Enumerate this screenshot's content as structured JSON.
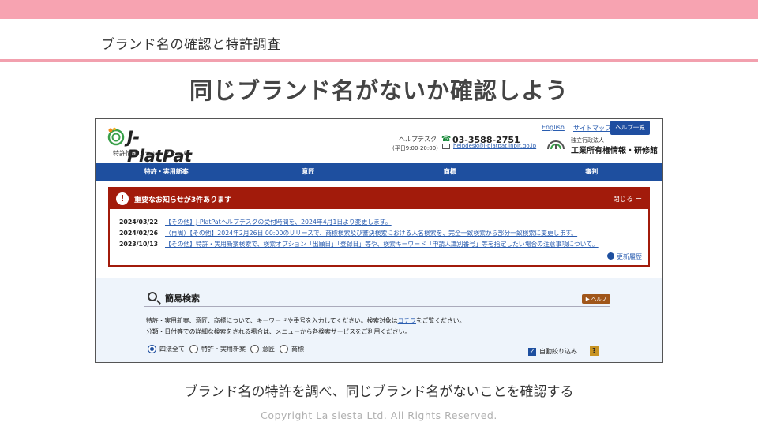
{
  "slide": {
    "header": "ブランド名の確認と特許調査",
    "title": "同じブランド名がないか確認しよう",
    "caption": "ブランド名の特許を調べ、同じブランド名がないことを確認する",
    "copyright": "Copyright La siesta Ltd. All Rights Reserved."
  },
  "jpp": {
    "logo": {
      "name": "J-PlatPat",
      "subtitle": "特許情報プラットフォーム"
    },
    "helpdesk": {
      "label": "ヘルプデスク",
      "hours": "(平日9:00-20:00)",
      "phone": "03-3588-2751",
      "email": "helpdesk@j-platpat.inpit.go.jp"
    },
    "top_links": {
      "english": "English",
      "sitemap": "サイトマップ",
      "help": "ヘルプ一覧"
    },
    "org": {
      "type": "独立行政法人",
      "name": "工業所有権情報・研修館"
    },
    "nav": [
      "特許・実用新案",
      "意匠",
      "商標",
      "審判"
    ],
    "notice": {
      "title": "重要なお知らせが3件あります",
      "close": "閉じる ー",
      "items": [
        {
          "date": "2024/03/22",
          "text": "【その他】J-PlatPatヘルプデスクの受付時間を、2024年4月1日より変更します。"
        },
        {
          "date": "2024/02/26",
          "text": "（再周）【その他】2024年2月26日 00:00のリリースで、商標検索及び審決検索における人名検索を、完全一致検索から部分一致検索に変更します。"
        },
        {
          "date": "2023/10/13",
          "text": "【その他】特許・実用新案検索で、検索オプション「出願日」「登録日」等や、検索キーワード「申請人識別番号」等を指定したい場合の注意事項について。"
        }
      ],
      "update_history": "更新履歴"
    },
    "search": {
      "title": "簡易検索",
      "help": "▶ ヘルプ",
      "desc1_prefix": "特許・実用新案、意匠、商標について、キーワードや番号を入力してください。検索対象は",
      "desc1_link": "コチラ",
      "desc1_suffix": "をご覧ください。",
      "desc2": "分類・日付等での詳細な検索をされる場合は、メニューから各検索サービスをご利用ください。",
      "radios": [
        "四法全て",
        "特許・実用新案",
        "意匠",
        "商標"
      ],
      "auto_filter": "自動絞り込み",
      "question": "?"
    }
  }
}
